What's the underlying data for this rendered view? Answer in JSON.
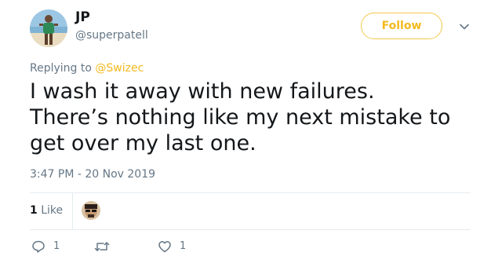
{
  "author": {
    "display_name": "JP",
    "username": "@superpatell"
  },
  "header": {
    "follow_label": "Follow"
  },
  "reply": {
    "prefix": "Replying to ",
    "handle": "@Swizec"
  },
  "tweet": {
    "lines": [
      "I wash it away with new failures.",
      "There’s nothing like my next mistake to",
      "get over my last one."
    ],
    "timestamp": "3:47 PM - 20 Nov 2019"
  },
  "stats": {
    "likes_count": "1",
    "likes_label": "Like"
  },
  "actions": {
    "reply_count": "1",
    "retweet_count": "",
    "like_count": "1"
  },
  "icons": {
    "caret": "chevron-down-icon",
    "reply": "reply-icon",
    "retweet": "retweet-icon",
    "like": "heart-icon"
  },
  "colors": {
    "accent": "#f2b91e",
    "text": "#14171a",
    "secondary": "#657786",
    "divider": "#e6ecf0"
  }
}
